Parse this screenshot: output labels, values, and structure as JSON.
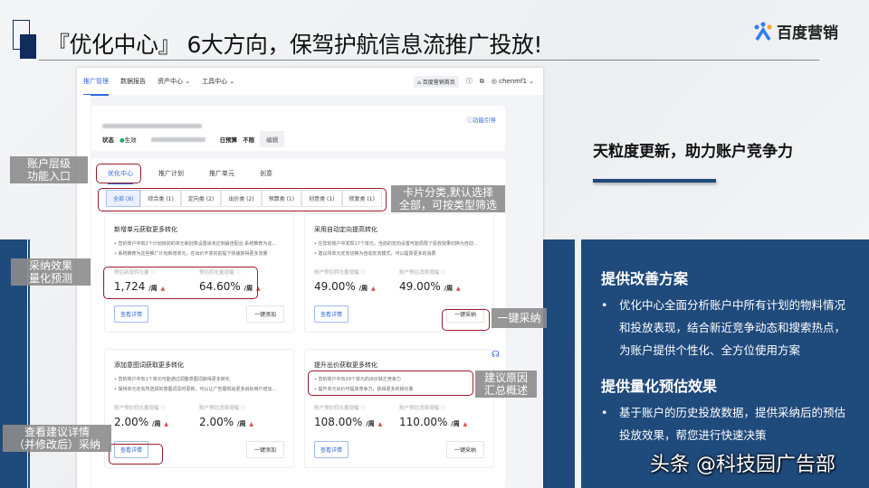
{
  "slide": {
    "title": "『优化中心』 6大方向，保驾护航信息流推广投放!",
    "logo": "百度营销"
  },
  "app": {
    "nav": [
      "推广管理",
      "数据报告",
      "资产中心",
      "工具中心"
    ],
    "home": "百度营销首页",
    "user": "chenmf1",
    "account": {
      "status_label": "状态",
      "status_value": "生效",
      "budget_label": "日预算",
      "budget_value": "不限",
      "edit": "编辑",
      "guide": "功能引导"
    },
    "tabs": [
      "优化中心",
      "推广计划",
      "推广单元",
      "创意"
    ],
    "chips": [
      "全部 (8)",
      "综合类 (1)",
      "定向类 (2)",
      "出价类 (2)",
      "预算类 (1)",
      "创意类 (1)",
      "修复类 (1)"
    ],
    "cards": [
      {
        "title": "新增单元获取更多转化",
        "bullets": [
          "• 您的账户中有2个计划目前的单元和创意设置尚未达到最佳配合,系统推荐为这...",
          "• 系统推荐为这些推广计划新增单元，在出价不变的前提下快速获得更多流量"
        ],
        "metrics": [
          {
            "label": "预估新增转化量",
            "value": "1,724",
            "unit": "/周"
          },
          {
            "label": "预估转化量增幅",
            "value": "64.60%",
            "unit": "/周"
          }
        ],
        "detail": "查看详情",
        "action": "一键添加"
      },
      {
        "title": "采用自动定向提高转化",
        "bullets": [
          "• 在您的账户中发现17个单元，当前的定向设置可能局限了投放效果切换为自动...",
          "• 建议将单元定向切换为自动定向模式，可以提高更多的消费"
        ],
        "metrics": [
          {
            "label": "账户预估转化量增幅",
            "value": "49.00%",
            "unit": "/周"
          },
          {
            "label": "账户预估消费增幅",
            "value": "49.00%",
            "unit": "/周"
          }
        ],
        "detail": "查看详情",
        "action": "一键采纳"
      },
      {
        "title": "添加意图词获取更多转化",
        "bullets": [
          "• 您的账户中有1个单元可能通过调整意图词获得更多转化",
          "• 保持单元定向所选择的意图词及时更新，可以让广告展现给更多目标用户增加..."
        ],
        "metrics": [
          {
            "label": "账户预估转化量增幅",
            "value": "2.00%",
            "unit": "/周"
          },
          {
            "label": "账户预估消费增幅",
            "value": "2.00%",
            "unit": "/周"
          }
        ],
        "detail": "查看详情",
        "action": "一键添加"
      },
      {
        "title": "提升出价获取更多转化",
        "bullets": [
          "• 您的账户中有29个单元的出价缺乏竞争力",
          "• 提升单元出价可提高竞争力，获得更多的转化量"
        ],
        "metrics": [
          {
            "label": "账户预估转化量增幅",
            "value": "108.00%",
            "unit": "/周"
          },
          {
            "label": "账户预估消费增幅",
            "value": "110.00%",
            "unit": "/周"
          }
        ],
        "detail": "查看详情",
        "action": "一键采纳"
      }
    ]
  },
  "annotations": {
    "entry": "账户层级\n功能入口",
    "filter": "卡片分类,默认选择\n全部，可按类型筛选",
    "forecast": "采纳效果\n量化预测",
    "adopt": "一键采纳",
    "reason": "建议原因\n汇总概述",
    "detail": "查看建议详情\n（并修改后）采纳"
  },
  "right": {
    "heading": "天粒度更新，助力账户竞争力",
    "sections": [
      {
        "title": "提供改善方案",
        "bullet": "优化中心全面分析账户中所有计划的物料情况和投放表现，结合新近竞争动态和搜索热点，为账户提供个性化、全方位使用方案"
      },
      {
        "title": "提供量化预估效果",
        "bullet": "基于账户的历史投放数据，提供采纳后的预估投放效果，帮您进行快速决策"
      }
    ]
  },
  "watermark": "头条 @科技园广告部",
  "colors": {
    "navy": "#1f4a7c",
    "accent": "#2f6bd9",
    "highlight": "#9b1c2c"
  }
}
